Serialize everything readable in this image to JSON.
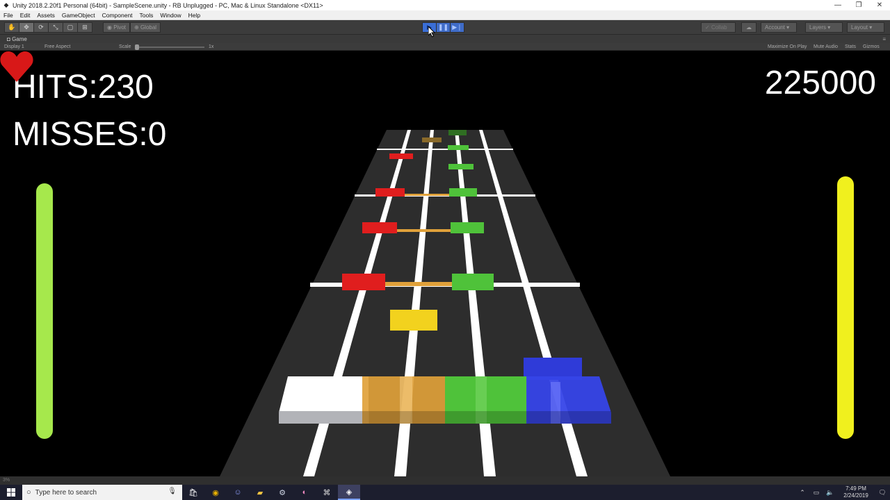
{
  "window": {
    "title": "Unity 2018.2.20f1 Personal (64bit) - SampleScene.unity - RB Unplugged - PC, Mac & Linux Standalone <DX11>",
    "minimize_glyph": "—",
    "maximize_glyph": "❐",
    "close_glyph": "✕"
  },
  "menu": [
    "File",
    "Edit",
    "Assets",
    "GameObject",
    "Component",
    "Tools",
    "Window",
    "Help"
  ],
  "toolbar": {
    "pivot_label": "Pivot",
    "global_label": "Global",
    "collab_label": "Collab",
    "account_label": "Account",
    "layers_label": "Layers",
    "layout_label": "Layout"
  },
  "game_tab": {
    "label": "Game",
    "display": "Display 1",
    "aspect": "Free Aspect",
    "scale_label": "Scale",
    "scale_value": "1x",
    "maximize_on_play": "Maximize On Play",
    "mute_audio": "Mute Audio",
    "stats": "Stats",
    "gizmos": "Gizmos"
  },
  "hud": {
    "hits_label": "HITS:",
    "hits_value": "230",
    "misses_label": "MISSES:",
    "misses_value": "0",
    "score": "225000"
  },
  "meters": {
    "health_fraction": 1.0,
    "power_fraction": 1.0,
    "health_color": "#a6e84c",
    "power_color": "#f0f01e"
  },
  "lane_colors": {
    "white": "#ffffff",
    "orange": "#e0a13a",
    "green": "#4fc23a",
    "blue": "#2f3bd8",
    "red": "#e01e1e",
    "yellow": "#f2d21e"
  },
  "status_text": "3%",
  "taskbar": {
    "search_placeholder": "Type here to search",
    "time": "7:49 PM",
    "date": "2/24/2019",
    "icons": [
      "store-icon",
      "chrome-icon",
      "discord-icon",
      "explorer-icon",
      "steam-icon",
      "game-icon",
      "controller-icon",
      "unity-icon"
    ]
  }
}
